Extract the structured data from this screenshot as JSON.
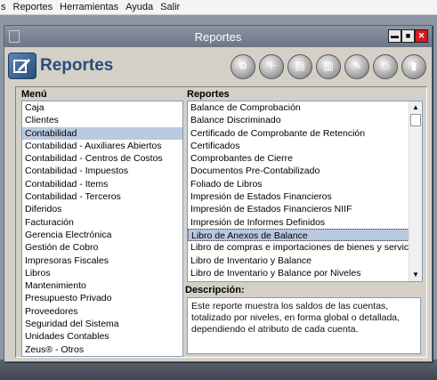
{
  "menubar": {
    "items": [
      "s",
      "Reportes",
      "Herramientas",
      "Ayuda",
      "Salir"
    ]
  },
  "window": {
    "title": "Reportes",
    "controls": {
      "minimize": "▬",
      "maximize": "■",
      "close": "✕"
    }
  },
  "header": {
    "app_name": "Reportes",
    "toolbar_icons": [
      "gear-settings-icon",
      "add-icon",
      "document-icon",
      "book-icon",
      "edit-icon",
      "print-icon",
      "exit-door-icon"
    ]
  },
  "menu": {
    "label": "Menú",
    "selected": "Contabilidad",
    "items": [
      "Caja",
      "Clientes",
      "Contabilidad",
      "Contabilidad - Auxiliares Abiertos",
      "Contabilidad - Centros de Costos",
      "Contabilidad - Impuestos",
      "Contabilidad - Items",
      "Contabilidad - Terceros",
      "Diferidos",
      "Facturación",
      "Gerencia Electrónica",
      "Gestión de Cobro",
      "Impresoras Fiscales",
      "Libros",
      "Mantenimiento",
      "Presupuesto Privado",
      "Proveedores",
      "Seguridad del Sistema",
      "Unidades Contables",
      "Zeus® - Otros"
    ]
  },
  "reports": {
    "label": "Reportes",
    "selected": "Libro de Anexos de Balance",
    "items": [
      "Balance de Comprobación",
      "Balance Discriminado",
      "Certificado de Comprobante de Retención",
      "Certificados",
      "Comprobantes de Cierre",
      "Documentos Pre-Contabilizado",
      "Foliado de Libros",
      "Impresión de Estados Financieros",
      "Impresión de Estados Financieros NIIF",
      "Impresión de Informes Definidos",
      "Libro de Anexos de Balance",
      "Libro de compras e importaciones de bienes y servicios",
      "Libro de Inventario y Balance",
      "Libro de Inventario y Balance por Niveles"
    ]
  },
  "description": {
    "label": "Descripción:",
    "text": "Este reporte muestra  los saldos de las cuentas, totalizado por niveles, en forma global o detallada,  dependiendo el atributo de cada  cuenta."
  }
}
